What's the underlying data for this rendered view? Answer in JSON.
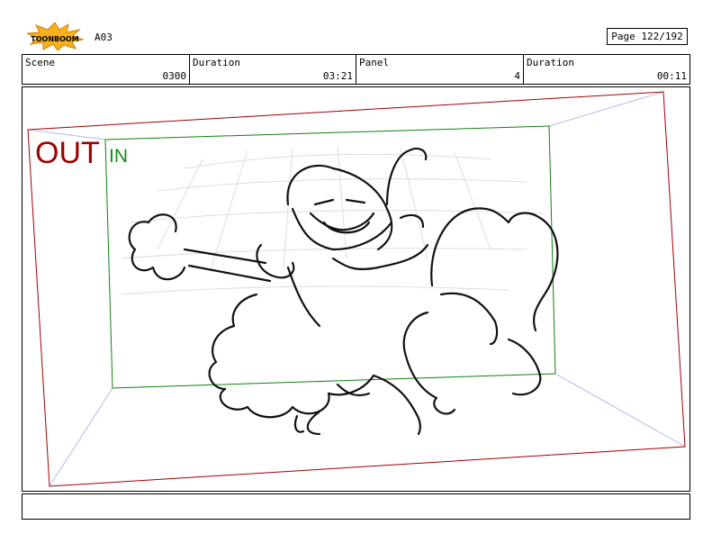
{
  "header": {
    "sequence": "A03",
    "page": "Page 122/192"
  },
  "info": {
    "scene_label": "Scene",
    "scene_value": "0300",
    "scene_duration_label": "Duration",
    "scene_duration_value": "03:21",
    "panel_label": "Panel",
    "panel_value": "4",
    "panel_duration_label": "Duration",
    "panel_duration_value": "00:11"
  },
  "frame": {
    "out_label": "OUT",
    "in_label": "IN",
    "out_color": "#a00000",
    "in_color": "#109010"
  },
  "caption": {
    "text": ""
  }
}
